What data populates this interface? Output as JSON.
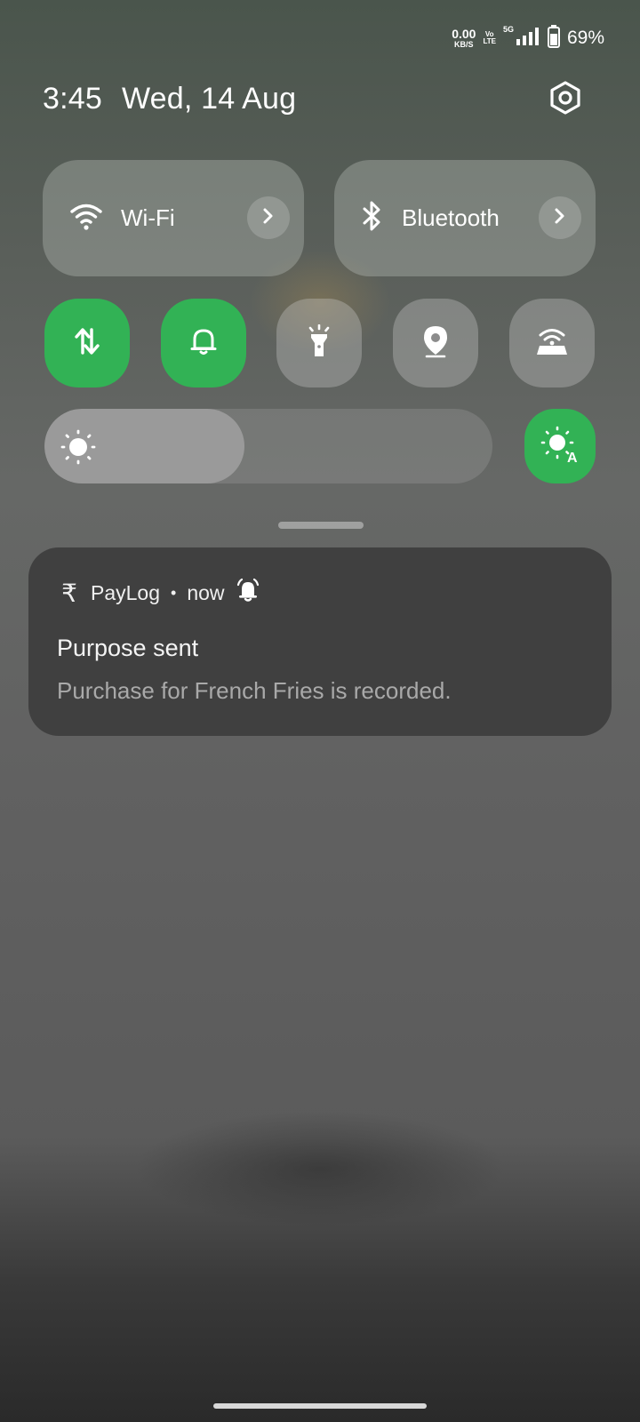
{
  "status_bar": {
    "net_speed_value": "0.00",
    "net_speed_unit": "KB/S",
    "volte_top": "Vo",
    "volte_bottom": "LTE",
    "network_type": "5G",
    "signal_icon": "signal-bars-icon",
    "battery_icon": "battery-icon",
    "battery_percent": "69%"
  },
  "header": {
    "time": "3:45",
    "date": "Wed, 14 Aug",
    "settings_icon": "settings-icon"
  },
  "quick_tiles": {
    "wifi": {
      "label": "Wi-Fi",
      "icon": "wifi-icon"
    },
    "bluetooth": {
      "label": "Bluetooth",
      "icon": "bluetooth-icon"
    },
    "toggles": [
      {
        "name": "mobile-data",
        "icon": "data-arrows-icon",
        "state": "on"
      },
      {
        "name": "sound",
        "icon": "bell-icon",
        "state": "on"
      },
      {
        "name": "flashlight",
        "icon": "flashlight-icon",
        "state": "off"
      },
      {
        "name": "location",
        "icon": "location-pin-icon",
        "state": "off"
      },
      {
        "name": "hotspot",
        "icon": "hotspot-icon",
        "state": "off"
      }
    ]
  },
  "brightness": {
    "level": 0.447,
    "auto": true,
    "auto_icon": "auto-brightness-icon"
  },
  "colors": {
    "active_green": "#32b255",
    "notification_bg": "#404040"
  },
  "notification": {
    "app_icon": "rupee-icon",
    "app_name": "PayLog",
    "separator": "•",
    "time": "now",
    "alert_icon": "bell-ring-icon",
    "title": "Purpose sent",
    "body": "Purchase for French Fries is recorded."
  }
}
